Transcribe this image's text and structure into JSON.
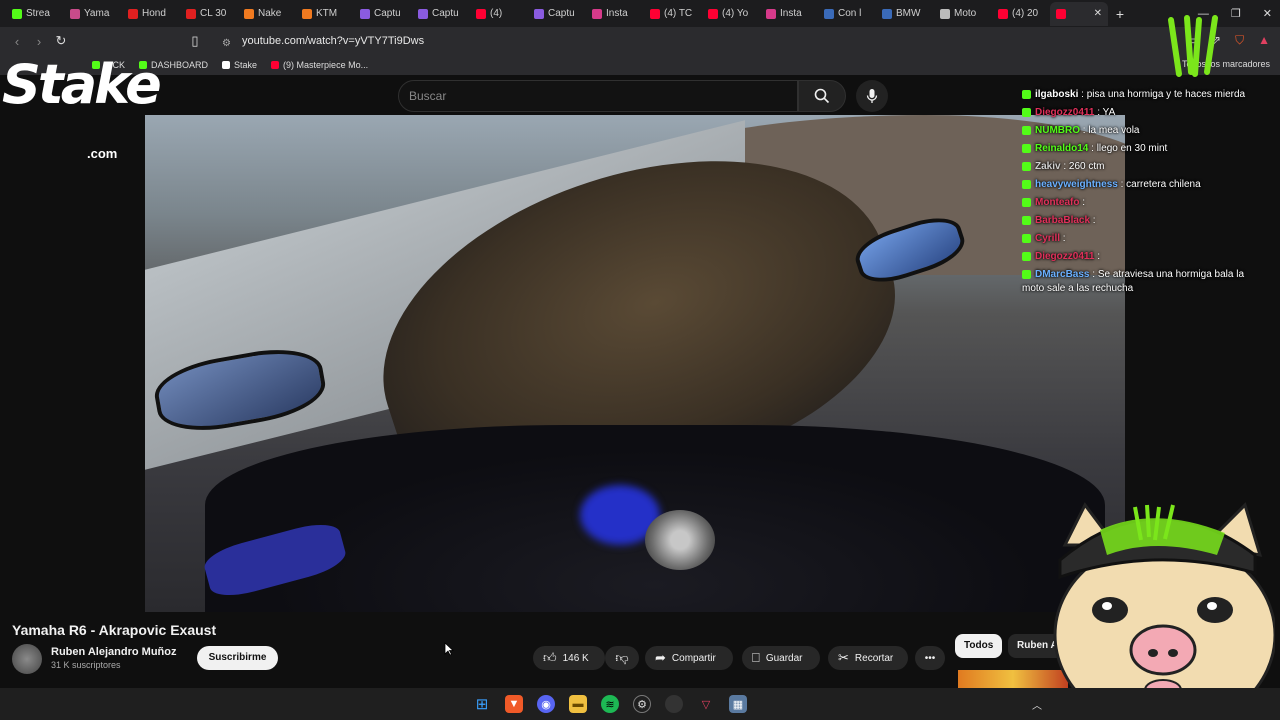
{
  "browser": {
    "tabs": [
      {
        "label": "Strea",
        "color": "#53fc18"
      },
      {
        "label": "Yama",
        "color": "#c84b8a"
      },
      {
        "label": "Hond",
        "color": "#e02020"
      },
      {
        "label": "CL 30",
        "color": "#e02020"
      },
      {
        "label": "Nake",
        "color": "#f07a20"
      },
      {
        "label": "KTM",
        "color": "#f07a20"
      },
      {
        "label": "Captu",
        "color": "#8a5be0"
      },
      {
        "label": "Captu",
        "color": "#8a5be0"
      },
      {
        "label": "(4)",
        "color": "#ff0033"
      },
      {
        "label": "Captu",
        "color": "#8a5be0"
      },
      {
        "label": "Insta",
        "color": "#d63a8a"
      },
      {
        "label": "(4) TC",
        "color": "#ff0033"
      },
      {
        "label": "(4) Yo",
        "color": "#ff0033"
      },
      {
        "label": "Insta",
        "color": "#d63a8a"
      },
      {
        "label": "Con l",
        "color": "#3a6ab8"
      },
      {
        "label": "BMW",
        "color": "#3a6ab8"
      },
      {
        "label": "Moto",
        "color": "#bbbbbb"
      },
      {
        "label": "(4) 20",
        "color": "#ff0033"
      },
      {
        "label": "",
        "color": "#ff0033"
      }
    ],
    "url": "youtube.com/watch?v=yVTY7Ti9Dws",
    "bookmarks": [
      {
        "label": "KICK",
        "color": "#53fc18"
      },
      {
        "label": "DASHBOARD",
        "color": "#53fc18"
      },
      {
        "label": "Stake",
        "color": "#ffffff"
      },
      {
        "label": "(9) Masterpiece Mo...",
        "color": "#ff0033"
      }
    ],
    "bookmarks_right": "Todos los marcadores"
  },
  "overlay": {
    "stake_word": "Stake",
    "stake_sub": ".com"
  },
  "youtube": {
    "search_placeholder": "Buscar",
    "video_title": "Yamaha R6 - Akrapovic Exaust",
    "channel_name": "Ruben Alejandro Muñoz",
    "subscribers": "31 K suscriptores",
    "subscribe_label": "Suscribirme",
    "likes": "146 K",
    "share_label": "Compartir",
    "save_label": "Guardar",
    "clip_label": "Recortar",
    "more_label": "•••",
    "chip_all": "Todos",
    "chip_channel": "Ruben Al"
  },
  "chat": [
    {
      "name": "ilgaboski",
      "text": ": pisa una hormiga y te haces mierda",
      "color": "#ffffff"
    },
    {
      "name": "Diegozz0411",
      "text": ": YA",
      "color": "#e0305a"
    },
    {
      "name": "NUMBRO",
      "text": ": la mea vola",
      "color": "#53fc18"
    },
    {
      "name": "Reinaldo14",
      "text": ": llego en 30 mint",
      "color": "#53fc18"
    },
    {
      "name": "Zakiv",
      "text": ": 260 ctm",
      "color": "#cfcfcf"
    },
    {
      "name": "heavyweightness",
      "text": ": carretera chilena",
      "color": "#6ab0ff"
    },
    {
      "name": "Monteafo",
      "text": ":",
      "color": "#e0305a"
    },
    {
      "name": "BarbaBlack",
      "text": ":",
      "color": "#e0305a"
    },
    {
      "name": "Cyrill",
      "text": ":",
      "color": "#e0305a"
    },
    {
      "name": "Diegozz0411",
      "text": ":",
      "color": "#e0305a"
    },
    {
      "name": "DMarcBass",
      "text": ": Se atraviesa una hormiga bala la moto sale a las rechucha",
      "color": "#6ab0ff"
    }
  ],
  "colors": {
    "yt_bg": "#0f0f0f",
    "kick_green": "#53fc18",
    "monster_green": "#7be61b"
  }
}
